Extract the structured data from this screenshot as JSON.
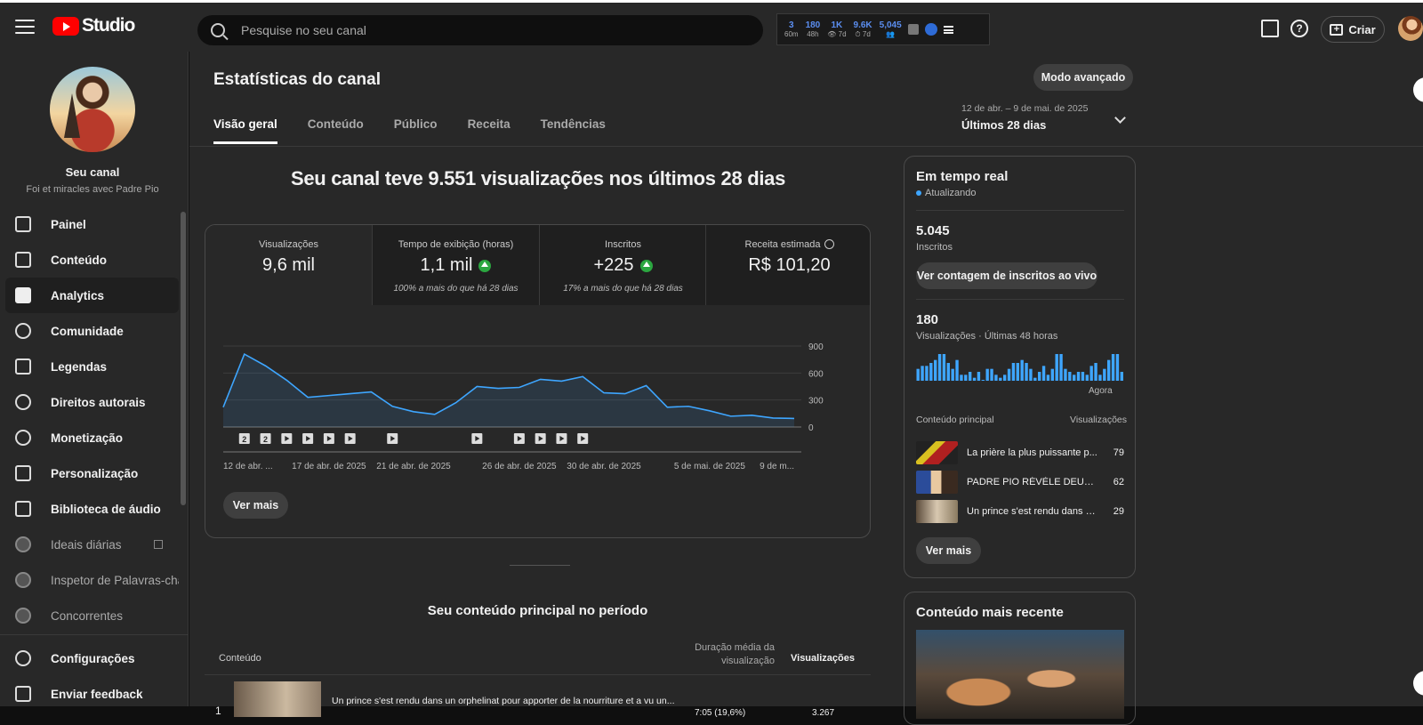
{
  "topbar": {
    "logo_text": "Studio",
    "search_placeholder": "Pesquise no seu canal",
    "widget": [
      {
        "n": "3",
        "l": "60m"
      },
      {
        "n": "180",
        "l": "48h"
      },
      {
        "n": "1K",
        "l": "👁 7d"
      },
      {
        "n": "9.6K",
        "l": "⏱ 7d"
      },
      {
        "n": "5,045",
        "l": "👥"
      }
    ],
    "create_label": "Criar"
  },
  "sidebar": {
    "channel_name": "Seu canal",
    "channel_sub": "Foi et miracles avec Padre Pio",
    "items": [
      {
        "label": "Painel",
        "icon": "dashboard-icon"
      },
      {
        "label": "Conteúdo",
        "icon": "content-icon"
      },
      {
        "label": "Analytics",
        "icon": "analytics-icon"
      },
      {
        "label": "Comunidade",
        "icon": "community-icon"
      },
      {
        "label": "Legendas",
        "icon": "subtitles-icon"
      },
      {
        "label": "Direitos autorais",
        "icon": "copyright-icon"
      },
      {
        "label": "Monetização",
        "icon": "dollar-icon"
      },
      {
        "label": "Personalização",
        "icon": "magic-wand-icon"
      },
      {
        "label": "Biblioteca de áudio",
        "icon": "audio-library-icon"
      },
      {
        "label": "Ideais diárias",
        "icon": "extension-icon"
      },
      {
        "label": "Inspetor de Palavras-chav",
        "icon": "extension-icon"
      },
      {
        "label": "Concorrentes",
        "icon": "extension-icon"
      }
    ],
    "settings_label": "Configurações",
    "feedback_label": "Enviar feedback"
  },
  "main": {
    "title": "Estatísticas do canal",
    "advanced_label": "Modo avançado",
    "tabs": [
      "Visão geral",
      "Conteúdo",
      "Público",
      "Receita",
      "Tendências"
    ],
    "date_range": "12 de abr. – 9 de mai. de 2025",
    "date_period": "Últimos 28 dias",
    "headline": "Seu canal teve 9.551 visualizações nos últimos 28 dias",
    "metrics": [
      {
        "label": "Visualizações",
        "value": "9,6 mil",
        "compare": ""
      },
      {
        "label": "Tempo de exibição (horas)",
        "value": "1,1 mil",
        "compare": "100% a mais do que há 28 dias"
      },
      {
        "label": "Inscritos",
        "value": "+225",
        "compare": "17% a mais do que há 28 dias"
      },
      {
        "label": "Receita estimada",
        "value": "R$ 101,20",
        "compare": ""
      }
    ],
    "see_more": "Ver mais",
    "top_content_title": "Seu conteúdo principal no período",
    "table": {
      "col_content": "Conteúdo",
      "col_duration_1": "Duração média da",
      "col_duration_2": "visualização",
      "col_views": "Visualizações",
      "rows": [
        {
          "num": "1",
          "title": "Un prince s'est rendu dans un orphelinat pour apporter de la nourriture et a vu un...",
          "duration": "7:05   (19,6%)",
          "views": "3.267"
        }
      ]
    }
  },
  "chart_data": {
    "type": "area",
    "x": [
      "12 de abr.",
      "13 de abr.",
      "14 de abr.",
      "15 de abr.",
      "16 de abr.",
      "17 de abr. de 2025",
      "18 de abr.",
      "19 de abr.",
      "20 de abr.",
      "21 de abr. de 2025",
      "22 de abr.",
      "23 de abr.",
      "24 de abr.",
      "25 de abr.",
      "26 de abr. de 2025",
      "27 de abr.",
      "28 de abr.",
      "29 de abr.",
      "30 de abr. de 2025",
      "1 de mai.",
      "2 de mai.",
      "3 de mai.",
      "4 de mai.",
      "5 de mai. de 2025",
      "6 de mai.",
      "7 de mai.",
      "8 de mai.",
      "9 de mai."
    ],
    "values": [
      220,
      810,
      680,
      520,
      330,
      350,
      370,
      390,
      230,
      170,
      140,
      270,
      450,
      430,
      440,
      530,
      510,
      560,
      380,
      370,
      460,
      220,
      230,
      180,
      120,
      130,
      100,
      95
    ],
    "tick_labels": [
      "12 de abr. ...",
      "17 de abr. de 2025",
      "21 de abr. de 2025",
      "26 de abr. de 2025",
      "30 de abr. de 2025",
      "5 de mai. de 2025",
      "9 de m..."
    ],
    "tick_index": [
      0,
      5,
      9,
      14,
      18,
      23,
      27
    ],
    "yticks": [
      0,
      300,
      600,
      900
    ],
    "ylim": [
      0,
      900
    ],
    "grid": true,
    "color": "#3ea6ff",
    "markers": [
      "2",
      "2",
      "▶",
      "▶",
      "▶",
      "▶",
      "▶",
      "▶",
      "▶",
      "▶",
      "▶",
      "▶"
    ],
    "marker_index": [
      1,
      2,
      3,
      4,
      5,
      6,
      8,
      12,
      14,
      15,
      16,
      17
    ]
  },
  "realtime": {
    "title": "Em tempo real",
    "status": "Atualizando",
    "subs_value": "5.045",
    "subs_label": "Inscritos",
    "subs_button": "Ver contagem de inscritos ao vivo",
    "views_value": "180",
    "views_label": "Visualizações · Últimas 48 horas",
    "now_label": "Agora",
    "col_left": "Conteúdo principal",
    "col_right": "Visualizações",
    "spark": [
      4,
      5,
      5,
      6,
      7,
      9,
      9,
      6,
      4,
      7,
      2,
      2,
      3,
      1,
      3,
      0,
      4,
      4,
      2,
      1,
      2,
      4,
      6,
      6,
      7,
      6,
      4,
      1,
      3,
      5,
      2,
      4,
      9,
      9,
      4,
      3,
      2,
      3,
      3,
      2,
      5,
      6,
      2,
      4,
      7,
      9,
      9,
      3
    ],
    "items": [
      {
        "title": "La prière la plus puissante p...",
        "views": "79"
      },
      {
        "title": "PADRE PIO RÉVÈLE DEUX M...",
        "views": "62"
      },
      {
        "title": "Un prince s'est rendu dans u...",
        "views": "29"
      }
    ],
    "see_more": "Ver mais"
  },
  "recent": {
    "title": "Conteúdo mais recente"
  }
}
